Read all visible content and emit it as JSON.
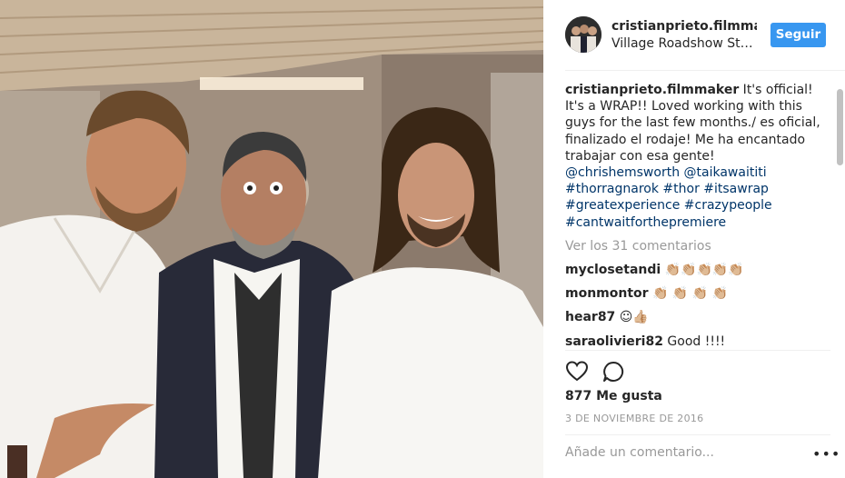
{
  "photo": {
    "alt_icon": "group-photo"
  },
  "header": {
    "username": "cristianprieto.filmmake",
    "location": "Village Roadshow St…",
    "follow_label": "Seguir"
  },
  "caption": {
    "username": "cristianprieto.filmmaker",
    "text": " It's official! It's a WRAP!! Loved working with this guys for the last few months./ es oficial, finalizado el rodaje! Me ha encantado trabajar con esa gente!",
    "mentions": "@chrishemsworth @taikawaititi #thorragnarok #thor #itsawrap #greatexperience #crazypeople #cantwaitforthepremiere"
  },
  "view_all": "Ver los 31 comentarios",
  "comments": [
    {
      "username": "myclosetandi",
      "text": " 👏🏼👏🏼👏🏼👏🏼👏🏼"
    },
    {
      "username": "monmontor",
      "text": " 👏🏼 👏🏼 👏🏼 👏🏼"
    },
    {
      "username": "hear87",
      "text": " ☺👍🏼"
    },
    {
      "username": "saraolivieri82",
      "text": " Good !!!!"
    }
  ],
  "actions": {
    "like_icon": "heart-icon",
    "comment_icon": "comment-icon"
  },
  "likes": "877 Me gusta",
  "date": "3 DE NOVIEMBRE DE 2016",
  "add_comment_placeholder": "Añade un comentario...",
  "more_label": "•••",
  "colors": {
    "follow": "#3897f0",
    "hashtag": "#003569",
    "muted": "#999999"
  }
}
